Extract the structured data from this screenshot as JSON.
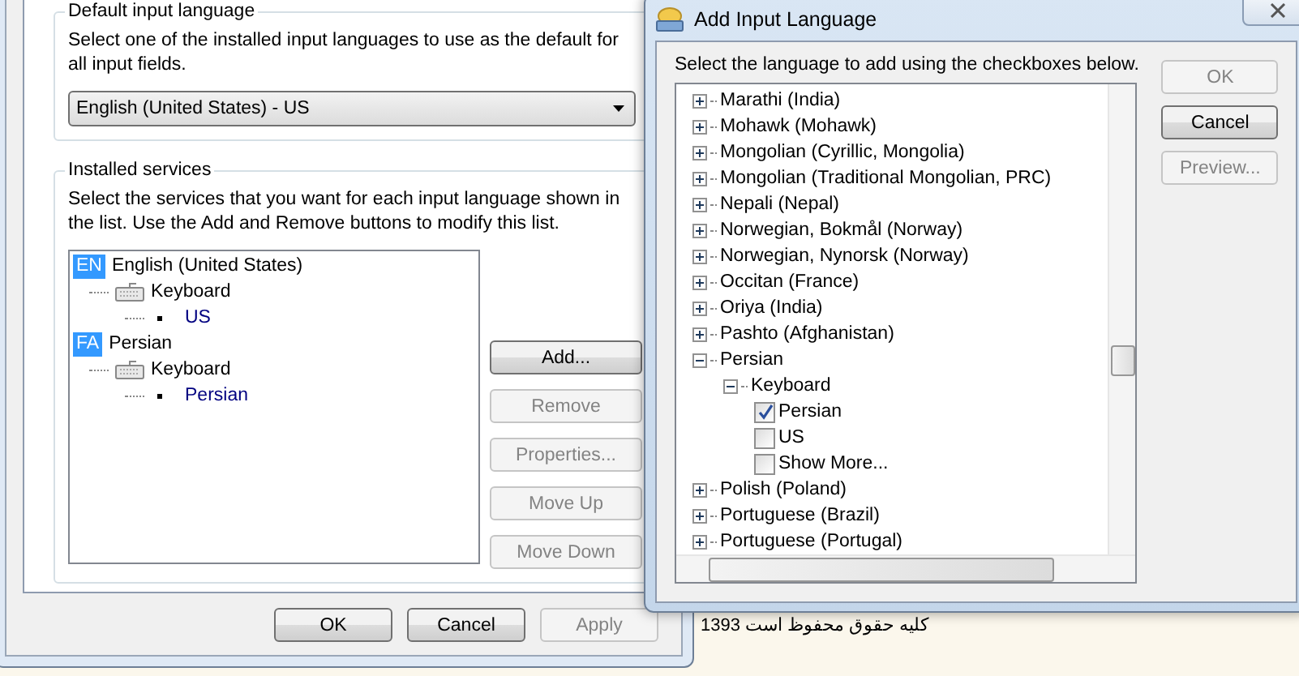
{
  "settings_dialog": {
    "default_language": {
      "title": "Default input language",
      "description": "Select one of the installed input languages to use as the default for all input fields.",
      "dropdown_value": "English (United States) - US"
    },
    "installed_services": {
      "title": "Installed services",
      "description": "Select the services that you want for each input language shown in the list. Use the Add and Remove buttons to modify this list.",
      "tree": [
        {
          "kind": "language",
          "badge": "EN",
          "label": "English (United States)",
          "children": [
            {
              "kind": "service",
              "label": "Keyboard",
              "children": [
                {
                  "kind": "layout",
                  "label": "US"
                }
              ]
            }
          ]
        },
        {
          "kind": "language",
          "badge": "FA",
          "label": "Persian",
          "children": [
            {
              "kind": "service",
              "label": "Keyboard",
              "children": [
                {
                  "kind": "layout",
                  "label": "Persian"
                }
              ]
            }
          ]
        }
      ],
      "buttons": [
        {
          "label": "Add...",
          "disabled": false
        },
        {
          "label": "Remove",
          "disabled": true
        },
        {
          "label": "Properties...",
          "disabled": true
        },
        {
          "label": "Move Up",
          "disabled": true
        },
        {
          "label": "Move Down",
          "disabled": true
        }
      ]
    },
    "footer_buttons": [
      {
        "label": "OK",
        "disabled": false
      },
      {
        "label": "Cancel",
        "disabled": false
      },
      {
        "label": "Apply",
        "disabled": true
      }
    ]
  },
  "add_language_dialog": {
    "title": "Add Input Language",
    "instruction": "Select the language to add using the checkboxes below.",
    "tree": [
      {
        "label": "Marathi (India)",
        "expanded": false
      },
      {
        "label": "Mohawk (Mohawk)",
        "expanded": false
      },
      {
        "label": "Mongolian (Cyrillic, Mongolia)",
        "expanded": false
      },
      {
        "label": "Mongolian (Traditional Mongolian, PRC)",
        "expanded": false
      },
      {
        "label": "Nepali (Nepal)",
        "expanded": false
      },
      {
        "label": "Norwegian, Bokmål (Norway)",
        "expanded": false
      },
      {
        "label": "Norwegian, Nynorsk (Norway)",
        "expanded": false
      },
      {
        "label": "Occitan (France)",
        "expanded": false
      },
      {
        "label": "Oriya (India)",
        "expanded": false
      },
      {
        "label": "Pashto (Afghanistan)",
        "expanded": false
      },
      {
        "label": "Persian",
        "expanded": true,
        "children": [
          {
            "label": "Keyboard",
            "expanded": true,
            "children": [
              {
                "label": "Persian",
                "checked": true
              },
              {
                "label": "US",
                "checked": false
              },
              {
                "label": "Show More...",
                "checked": false
              }
            ]
          }
        ]
      },
      {
        "label": "Polish (Poland)",
        "expanded": false
      },
      {
        "label": "Portuguese (Brazil)",
        "expanded": false
      },
      {
        "label": "Portuguese (Portugal)",
        "expanded": false
      }
    ],
    "buttons": [
      {
        "label": "OK",
        "disabled": true
      },
      {
        "label": "Cancel",
        "disabled": false
      },
      {
        "label": "Preview...",
        "disabled": true
      }
    ]
  },
  "background_text": "کلیه حقوق محفوظ است 1393"
}
